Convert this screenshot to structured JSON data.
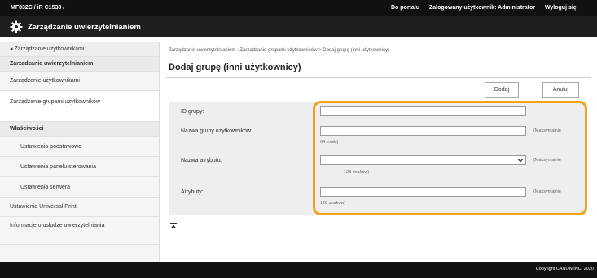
{
  "header": {
    "device_name": "MF832C / iR C1538 /",
    "portal_link": "Do portalu",
    "logged_user": "Zalogowany użytkownik: Administrator",
    "logout": "Wyloguj się",
    "app_title": "Zarządzanie uwierzytelnianiem"
  },
  "sidebar": {
    "back": "◂ Zarządzanie użytkownikami",
    "section_users": "Zarządzanie uwierzytelnianiem",
    "items": [
      {
        "label": "Zarządzanie użytkownikami"
      },
      {
        "label": "Zarządzanie grupami użytkowników"
      }
    ],
    "section_properties": "Właściwości",
    "subitems": [
      {
        "label": "Ustawienia podstawowe"
      },
      {
        "label": "Ustawienia panelu sterowania"
      },
      {
        "label": "Ustawienia serwera"
      }
    ],
    "bottom_items": [
      {
        "label": "Ustawienia Universal Print"
      },
      {
        "label": "Informacje o usłudze uwierzytelniania"
      }
    ]
  },
  "main": {
    "breadcrumb": "Zarządzanie uwierzytelnianiem : Zarządzanie grupami użytkowników > Dodaj grupę (inni użytkownicy)",
    "title": "Dodaj grupę (inni użytkownicy)",
    "buttons": {
      "ok": "Dodaj",
      "cancel": "Anuluj"
    },
    "fields": {
      "group_id": {
        "label": "ID grupy:",
        "value": ""
      },
      "group_name": {
        "label": "Nazwa grupy użytkowników:",
        "value": "",
        "max_right": "(Maksymalnie",
        "max_below": "64 znaki)"
      },
      "attribute_name": {
        "label": "Nazwa atrybutu:",
        "value": "",
        "max_right": "(Maksymalnie",
        "max_below": "128 znaków)"
      },
      "attributes": {
        "label": "Atrybuty:",
        "value": "",
        "max_right": "(Maksymalnie",
        "max_below": "128 znaków)"
      }
    }
  },
  "footer": {
    "copyright": "Copyright CANON INC. 2020"
  },
  "colors": {
    "highlight": "#f0a419",
    "topbar": "#111111"
  }
}
